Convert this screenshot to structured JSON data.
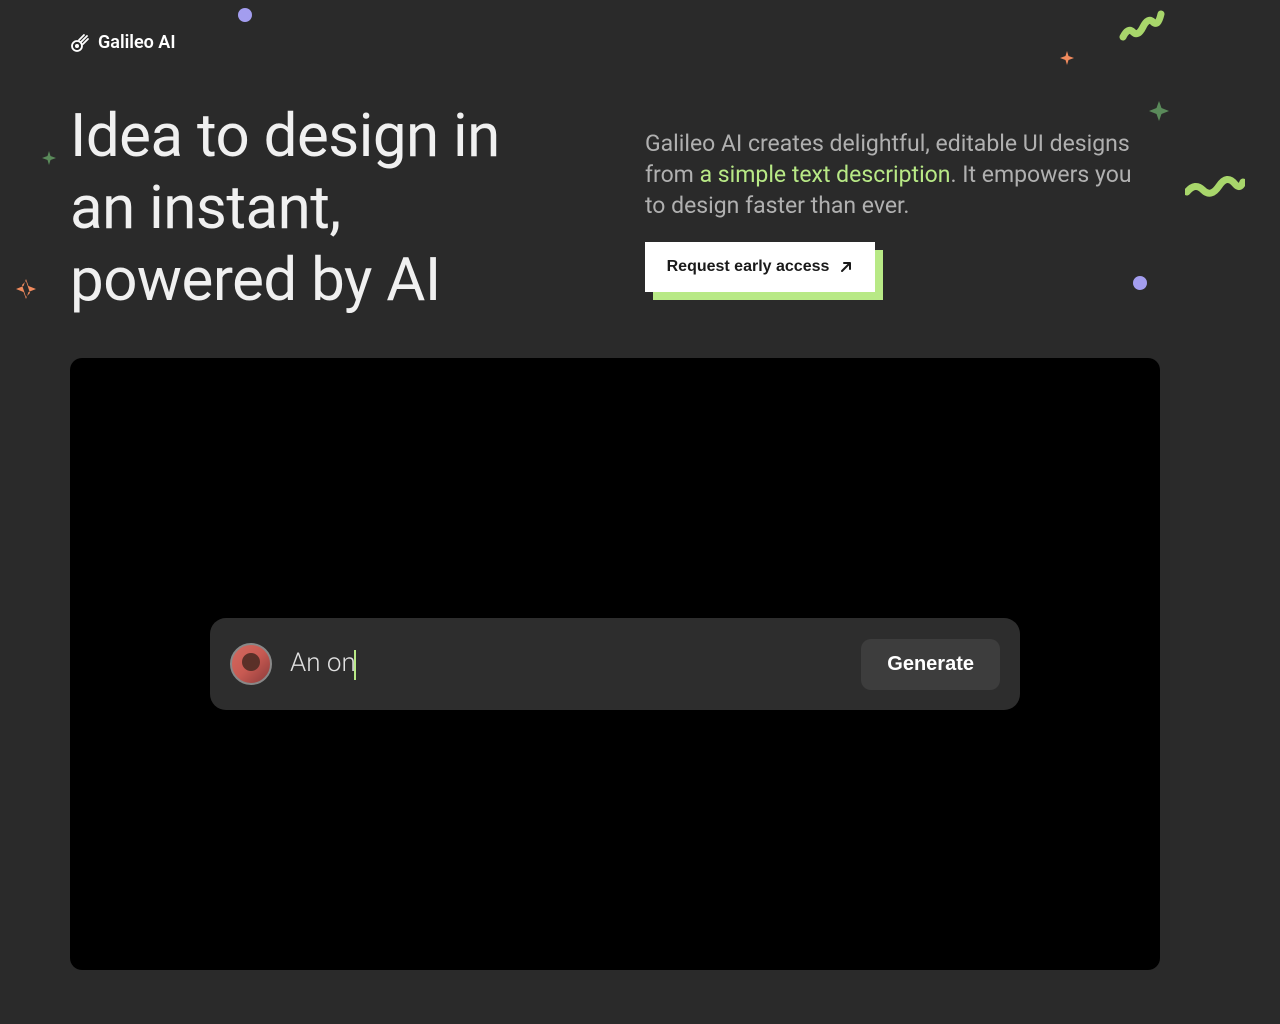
{
  "header": {
    "logo_text": "Galileo AI"
  },
  "hero": {
    "title": "Idea to design in an instant, powered by AI",
    "description_part1": "Galileo AI creates delightful, editable UI designs from ",
    "description_highlight": "a simple text description",
    "description_part2": ". It empowers you to design faster than ever."
  },
  "cta": {
    "label": "Request early access"
  },
  "demo": {
    "prompt_text": "An on",
    "generate_label": "Generate"
  },
  "colors": {
    "background": "#2a2a2a",
    "accent_green": "#b8e986",
    "accent_purple": "#a39def",
    "accent_orange": "#f08a5d"
  }
}
